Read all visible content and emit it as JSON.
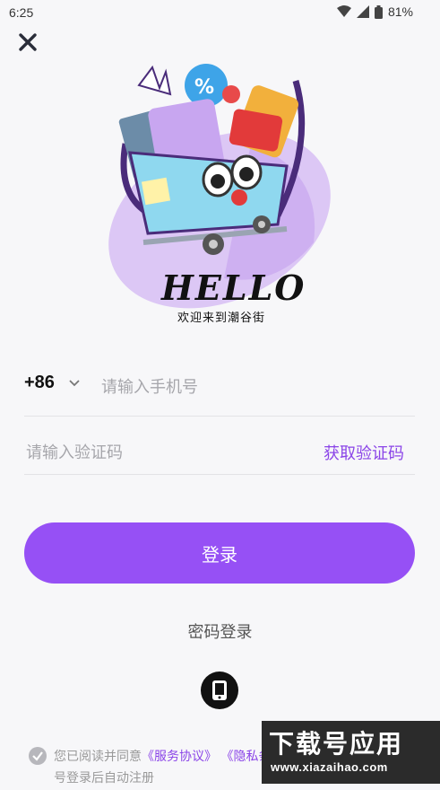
{
  "status_bar": {
    "time": "6:25",
    "battery": "81%"
  },
  "header": {
    "close_icon": "close-icon"
  },
  "hero": {
    "hello": "HELLO",
    "tagline": "欢迎来到潮谷街"
  },
  "phone": {
    "country_code": "+86",
    "placeholder": "请输入手机号"
  },
  "code": {
    "placeholder": "请输入验证码",
    "get_code_label": "获取验证码"
  },
  "login": {
    "button_label": "登录",
    "password_login": "密码登录"
  },
  "agreement": {
    "prefix": "您已阅读并同意",
    "service_link": "《服务协议》",
    "privacy_link": "《隐私条款》",
    "line2": "号登录后自动注册"
  },
  "watermark": {
    "title": "下载号应用",
    "url": "www.xiazaihao.com"
  },
  "colors": {
    "accent": "#9650f5",
    "link": "#8b45e8"
  }
}
